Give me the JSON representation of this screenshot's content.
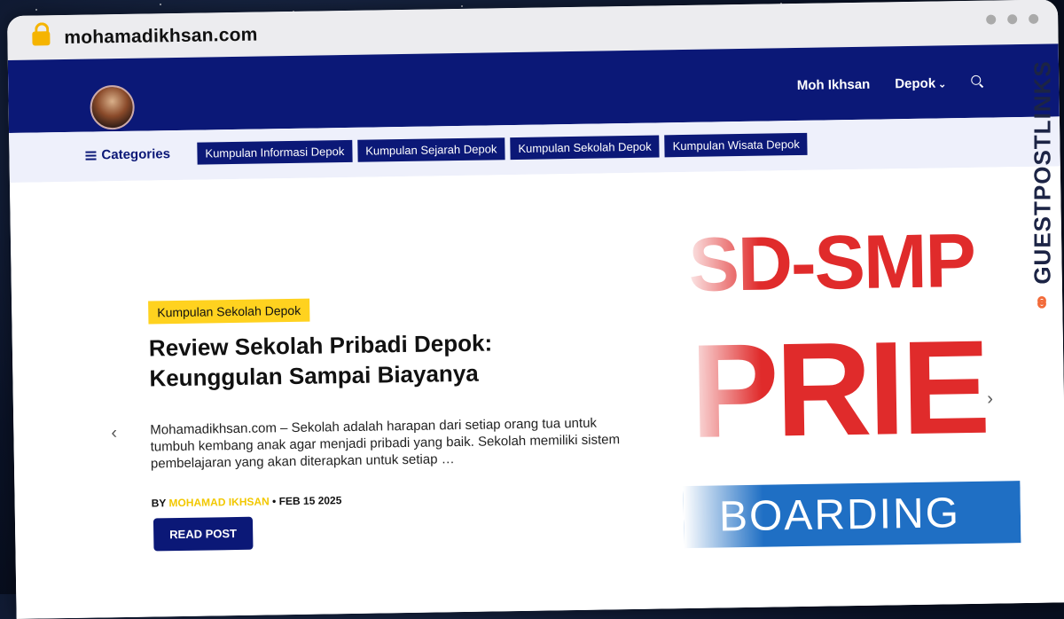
{
  "browser": {
    "url": "mohamadikhsan.com"
  },
  "header": {
    "nav": [
      {
        "label": "Moh Ikhsan"
      },
      {
        "label": "Depok"
      }
    ]
  },
  "categories": {
    "title": "Categories",
    "items": [
      "Kumpulan Informasi Depok",
      "Kumpulan Sejarah Depok",
      "Kumpulan Sekolah Depok",
      "Kumpulan Wisata Depok"
    ]
  },
  "post": {
    "tag": "Kumpulan Sekolah Depok",
    "title": "Review Sekolah Pribadi Depok: Keunggulan Sampai Biayanya",
    "excerpt": "Mohamadikhsan.com – Sekolah adalah harapan dari setiap orang tua untuk tumbuh kembang anak agar menjadi pribadi yang baik. Sekolah memiliki sistem pembelajaran yang akan diterapkan untuk setiap …",
    "by": "BY",
    "author": "MOHAMAD IKHSAN",
    "date": "• FEB 15 2025",
    "button": "READ POST"
  },
  "hero_image": {
    "line1": "SD-SMP",
    "line2": "PRIE",
    "band": "BOARDING"
  },
  "watermark": {
    "left": "GUESTPOST",
    "right": "LINKS"
  },
  "colors": {
    "brand": "#0b1877",
    "accent": "#ffd21f",
    "lock": "#f5b400"
  }
}
